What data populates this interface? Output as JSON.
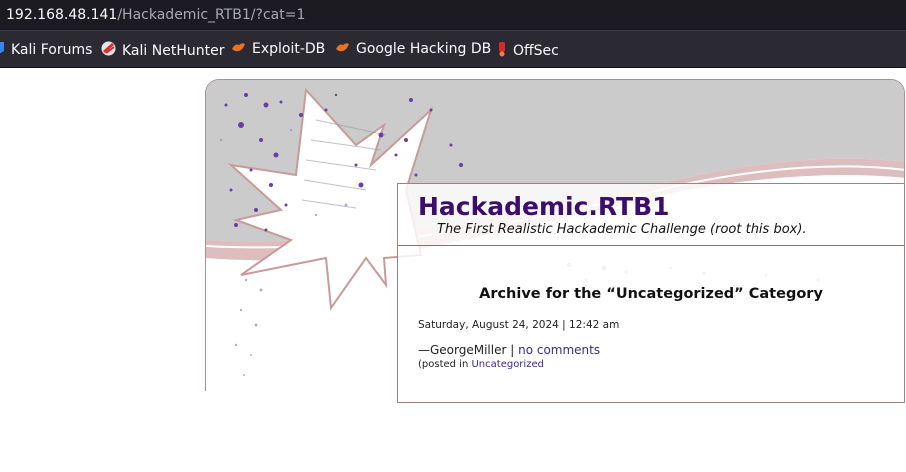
{
  "urlbar": {
    "host": "192.168.48.141",
    "path": "/Hackademic_RTB1/?cat=1"
  },
  "bookmarks": [
    {
      "label": "Kali Forums",
      "icon": "kali-forums-icon"
    },
    {
      "label": "Kali NetHunter",
      "icon": "nethunter-icon"
    },
    {
      "label": "Exploit-DB",
      "icon": "exploit-db-icon"
    },
    {
      "label": "Google Hacking DB",
      "icon": "ghdb-icon"
    },
    {
      "label": "OffSec",
      "icon": "offsec-icon"
    }
  ],
  "site": {
    "title": "Hackademic.RTB1",
    "tagline": "The First Realistic Hackademic Challenge (root this box)."
  },
  "archive": {
    "heading": "Archive for the “Uncategorized” Category"
  },
  "post": {
    "date": "Saturday, August 24, 2024 | 12:42 am",
    "author_prefix": "—GeorgeMiller | ",
    "comments_link": "no comments",
    "posted_prefix": "(posted in ",
    "category_link": "Uncategorized"
  },
  "colors": {
    "title": "#3d0d6b",
    "link": "#3d2a8a",
    "chrome_dark": "#1c1b22",
    "bookmarks_bar": "#2b2a33"
  }
}
